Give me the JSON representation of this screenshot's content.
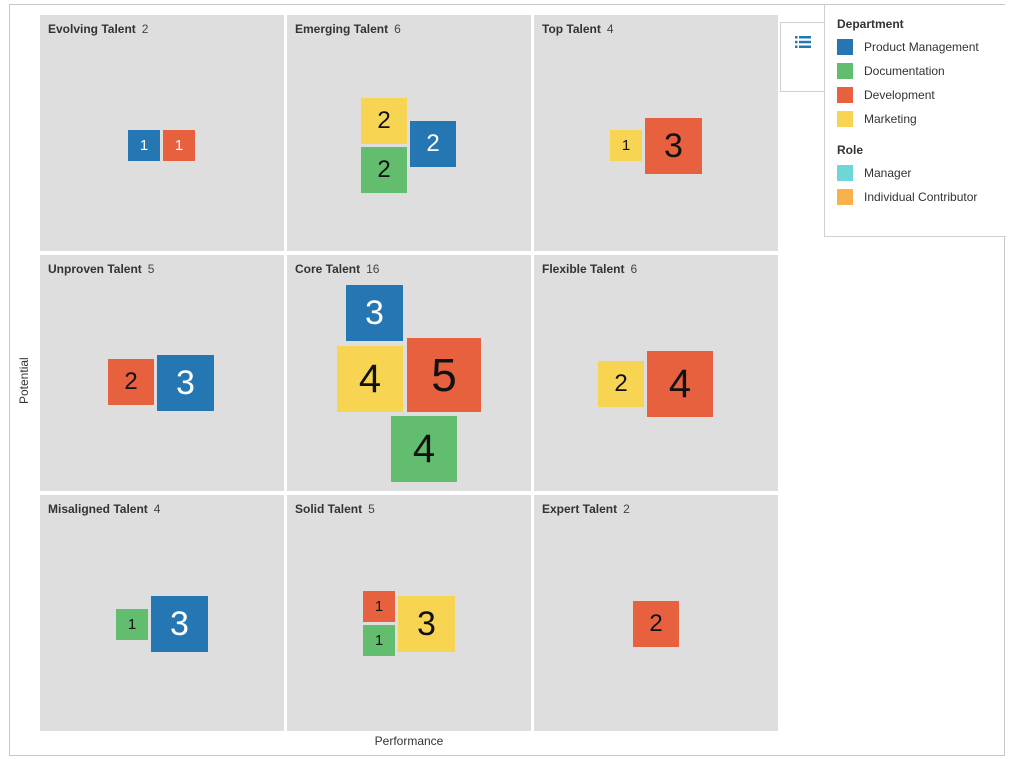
{
  "axes": {
    "x_label": "Performance",
    "y_label": "Potential"
  },
  "legend": {
    "toggle_icon": "list-icon",
    "department": {
      "title": "Department",
      "items": [
        {
          "label": "Product Management",
          "color": "#2477b3"
        },
        {
          "label": "Documentation",
          "color": "#63bd6e"
        },
        {
          "label": "Development",
          "color": "#e8613f"
        },
        {
          "label": "Marketing",
          "color": "#f7d452"
        }
      ]
    },
    "role": {
      "title": "Role",
      "items": [
        {
          "label": "Manager",
          "color": "#6fd6d8"
        },
        {
          "label": "Individual Contributor",
          "color": "#f9b24b"
        }
      ]
    }
  },
  "cells": [
    {
      "name": "Evolving Talent",
      "count": "2",
      "boxes": [
        {
          "dept": "pm",
          "value": "1"
        },
        {
          "dept": "dev",
          "value": "1"
        }
      ]
    },
    {
      "name": "Emerging Talent",
      "count": "6",
      "boxes": [
        {
          "dept": "mkt",
          "value": "2"
        },
        {
          "dept": "doc",
          "value": "2"
        },
        {
          "dept": "pm",
          "value": "2"
        }
      ]
    },
    {
      "name": "Top Talent",
      "count": "4",
      "boxes": [
        {
          "dept": "mkt",
          "value": "1"
        },
        {
          "dept": "dev",
          "value": "3"
        }
      ]
    },
    {
      "name": "Unproven Talent",
      "count": "5",
      "boxes": [
        {
          "dept": "dev",
          "value": "2"
        },
        {
          "dept": "pm",
          "value": "3"
        }
      ]
    },
    {
      "name": "Core Talent",
      "count": "16",
      "boxes": [
        {
          "dept": "pm",
          "value": "3"
        },
        {
          "dept": "mkt",
          "value": "4"
        },
        {
          "dept": "dev",
          "value": "5"
        },
        {
          "dept": "doc",
          "value": "4"
        }
      ]
    },
    {
      "name": "Flexible Talent",
      "count": "6",
      "boxes": [
        {
          "dept": "mkt",
          "value": "2"
        },
        {
          "dept": "dev",
          "value": "4"
        }
      ]
    },
    {
      "name": "Misaligned Talent",
      "count": "4",
      "boxes": [
        {
          "dept": "doc",
          "value": "1"
        },
        {
          "dept": "pm",
          "value": "3"
        }
      ]
    },
    {
      "name": "Solid Talent",
      "count": "5",
      "boxes": [
        {
          "dept": "dev",
          "value": "1"
        },
        {
          "dept": "doc",
          "value": "1"
        },
        {
          "dept": "mkt",
          "value": "3"
        }
      ]
    },
    {
      "name": "Expert Talent",
      "count": "2",
      "boxes": [
        {
          "dept": "dev",
          "value": "2"
        }
      ]
    }
  ]
}
